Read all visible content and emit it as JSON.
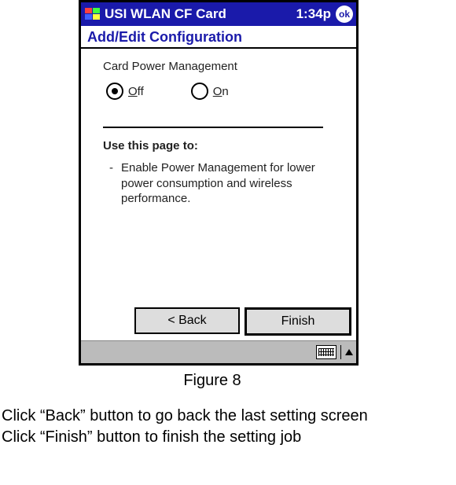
{
  "titlebar": {
    "title": "USI WLAN CF Card",
    "time": "1:34p",
    "ok": "ok"
  },
  "subheader": "Add/Edit Configuration",
  "content": {
    "section_label": "Card Power Management",
    "radio": {
      "off_prefix": "O",
      "off_rest": "ff",
      "on_prefix": "O",
      "on_rest": "n",
      "selected": "off"
    },
    "use_heading": "Use this page to:",
    "bullet_dash": "-",
    "bullet_text": "Enable Power Management for lower power consumption and wireless performance."
  },
  "buttons": {
    "back": "<  Back",
    "finish": "Finish"
  },
  "caption": "Figure 8",
  "instructions": {
    "line1": "Click “Back” button to go back the last setting screen",
    "line2": "Click “Finish” button to finish the setting job"
  }
}
